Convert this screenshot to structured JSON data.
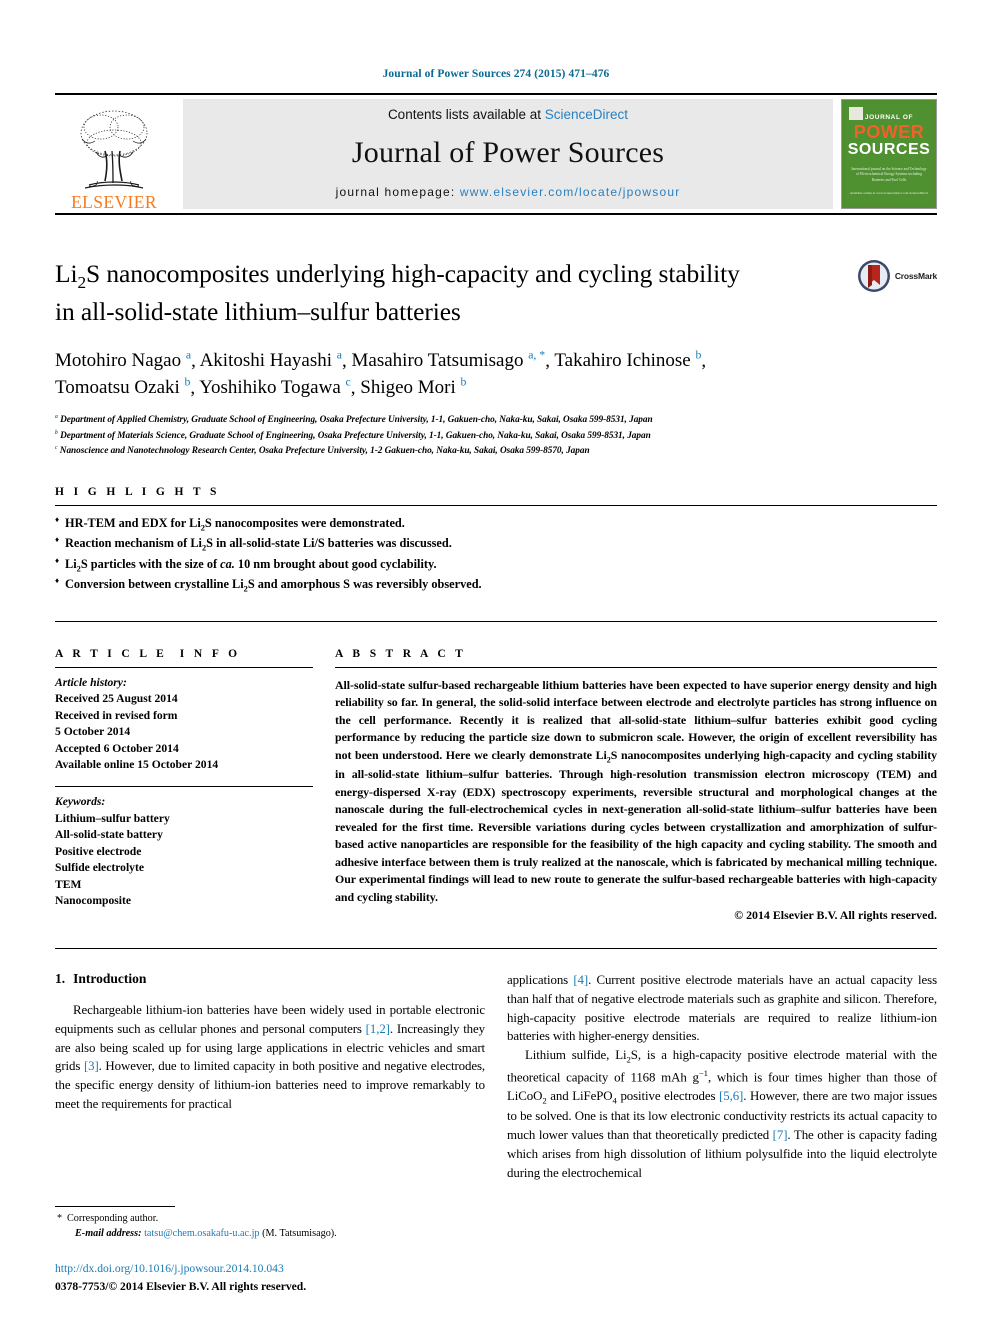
{
  "running_head": "Journal of Power Sources 274 (2015) 471–476",
  "masthead": {
    "contents_prefix": "Contents lists available at ",
    "contents_link": "ScienceDirect",
    "journal_name": "Journal of Power Sources",
    "homepage_prefix": "journal homepage: ",
    "homepage_url": "www.elsevier.com/locate/jpowsour",
    "publisher": "ELSEVIER",
    "cover": {
      "line_journal_of": "JOURNAL OF",
      "line_power": "POWER",
      "line_sources": "SOURCES",
      "subtitle": "International journal on the Science and Technology of Electrochemical Energy Systems including Batteries and Fuel Cells",
      "footer": "Available online at www.sciencedirect.com ScienceDirect"
    }
  },
  "article": {
    "title_line1": "Li2S nanocomposites underlying high-capacity and cycling stability",
    "title_line2": "in all-solid-state lithium–sulfur batteries",
    "crossmark_label": "CrossMark",
    "authors": [
      {
        "name": "Motohiro Nagao",
        "marks": "a"
      },
      {
        "name": "Akitoshi Hayashi",
        "marks": "a"
      },
      {
        "name": "Masahiro Tatsumisago",
        "marks": "a, *"
      },
      {
        "name": "Takahiro Ichinose",
        "marks": "b"
      },
      {
        "name": "Tomoatsu Ozaki",
        "marks": "b"
      },
      {
        "name": "Yoshihiko Togawa",
        "marks": "c"
      },
      {
        "name": "Shigeo Mori",
        "marks": "b"
      }
    ],
    "affiliations": [
      {
        "mark": "a",
        "text": "Department of Applied Chemistry, Graduate School of Engineering, Osaka Prefecture University, 1-1, Gakuen-cho, Naka-ku, Sakai, Osaka 599-8531, Japan"
      },
      {
        "mark": "b",
        "text": "Department of Materials Science, Graduate School of Engineering, Osaka Prefecture University, 1-1, Gakuen-cho, Naka-ku, Sakai, Osaka 599-8531, Japan"
      },
      {
        "mark": "c",
        "text": "Nanoscience and Nanotechnology Research Center, Osaka Prefecture University, 1-2 Gakuen-cho, Naka-ku, Sakai, Osaka 599-8570, Japan"
      }
    ]
  },
  "highlights": {
    "label": "HIGHLIGHTS",
    "items": [
      "HR-TEM and EDX for Li2S nanocomposites were demonstrated.",
      "Reaction mechanism of Li2S in all-solid-state Li/S batteries was discussed.",
      "Li2S particles with the size of ca. 10 nm brought about good cyclability.",
      "Conversion between crystalline Li2S and amorphous S was reversibly observed."
    ]
  },
  "article_info": {
    "label": "ARTICLE INFO",
    "history_label": "Article history:",
    "history": [
      "Received 25 August 2014",
      "Received in revised form",
      "5 October 2014",
      "Accepted 6 October 2014",
      "Available online 15 October 2014"
    ],
    "keywords_label": "Keywords:",
    "keywords": [
      "Lithium–sulfur battery",
      "All-solid-state battery",
      "Positive electrode",
      "Sulfide electrolyte",
      "TEM",
      "Nanocomposite"
    ]
  },
  "abstract": {
    "label": "ABSTRACT",
    "text": "All-solid-state sulfur-based rechargeable lithium batteries have been expected to have superior energy density and high reliability so far. In general, the solid-solid interface between electrode and electrolyte particles has strong influence on the cell performance. Recently it is realized that all-solid-state lithium–sulfur batteries exhibit good cycling performance by reducing the particle size down to submicron scale. However, the origin of excellent reversibility has not been understood. Here we clearly demonstrate Li2S nanocomposites underlying high-capacity and cycling stability in all-solid-state lithium–sulfur batteries. Through high-resolution transmission electron microscopy (TEM) and energy-dispersed X-ray (EDX) spectroscopy experiments, reversible structural and morphological changes at the nanoscale during the full-electrochemical cycles in next-generation all-solid-state lithium–sulfur batteries have been revealed for the first time. Reversible variations during cycles between crystallization and amorphization of sulfur-based active nanoparticles are responsible for the feasibility of the high capacity and cycling stability. The smooth and adhesive interface between them is truly realized at the nanoscale, which is fabricated by mechanical milling technique. Our experimental findings will lead to new route to generate the sulfur-based rechargeable batteries with high-capacity and cycling stability.",
    "copyright": "© 2014 Elsevier B.V. All rights reserved."
  },
  "introduction": {
    "number": "1.",
    "heading": "Introduction",
    "p1_part1": "Rechargeable lithium-ion batteries have been widely used in portable electronic equipments such as cellular phones and personal computers ",
    "p1_ref1": "[1,2]",
    "p1_part2": ". Increasingly they are also being scaled up for using large applications in electric vehicles and smart grids ",
    "p1_ref2": "[3]",
    "p1_part3": ". However, due to limited capacity in both positive and negative electrodes, the specific energy density of lithium-ion batteries need to improve remarkably to meet the requirements for practical applications ",
    "p1_ref3": "[4]",
    "p1_part4": ". Current positive electrode materials have an actual capacity less than half that of negative electrode materials such as graphite and silicon. Therefore, high-capacity positive electrode materials are required to realize lithium-ion batteries with higher-energy densities.",
    "p2_part1": "Lithium sulfide, Li2S, is a high-capacity positive electrode material with the theoretical capacity of 1168 mAh g",
    "p2_sup": "−1",
    "p2_part2": ", which is four times higher than those of LiCoO2 and LiFePO4 positive electrodes ",
    "p2_ref1": "[5,6]",
    "p2_part3": ". However, there are two major issues to be solved. One is that its low electronic conductivity restricts its actual capacity to much lower values than that theoretically predicted ",
    "p2_ref2": "[7]",
    "p2_part4": ". The other is capacity fading which arises from high dissolution of lithium polysulfide into the liquid electrolyte during the electrochemical"
  },
  "footer": {
    "corresponding_author": "Corresponding author.",
    "email_label": "E-mail address:",
    "email": "tatsu@chem.osakafu-u.ac.jp",
    "email_suffix": "(M. Tatsumisago).",
    "doi": "http://dx.doi.org/10.1016/j.jpowsour.2014.10.043",
    "issn_line": "0378-7753/© 2014 Elsevier B.V. All rights reserved."
  },
  "colors": {
    "link": "#1a7bb5",
    "running_head": "#0b6a94",
    "elsevier_orange": "#F47B20",
    "cover_green": "#4f9030"
  }
}
